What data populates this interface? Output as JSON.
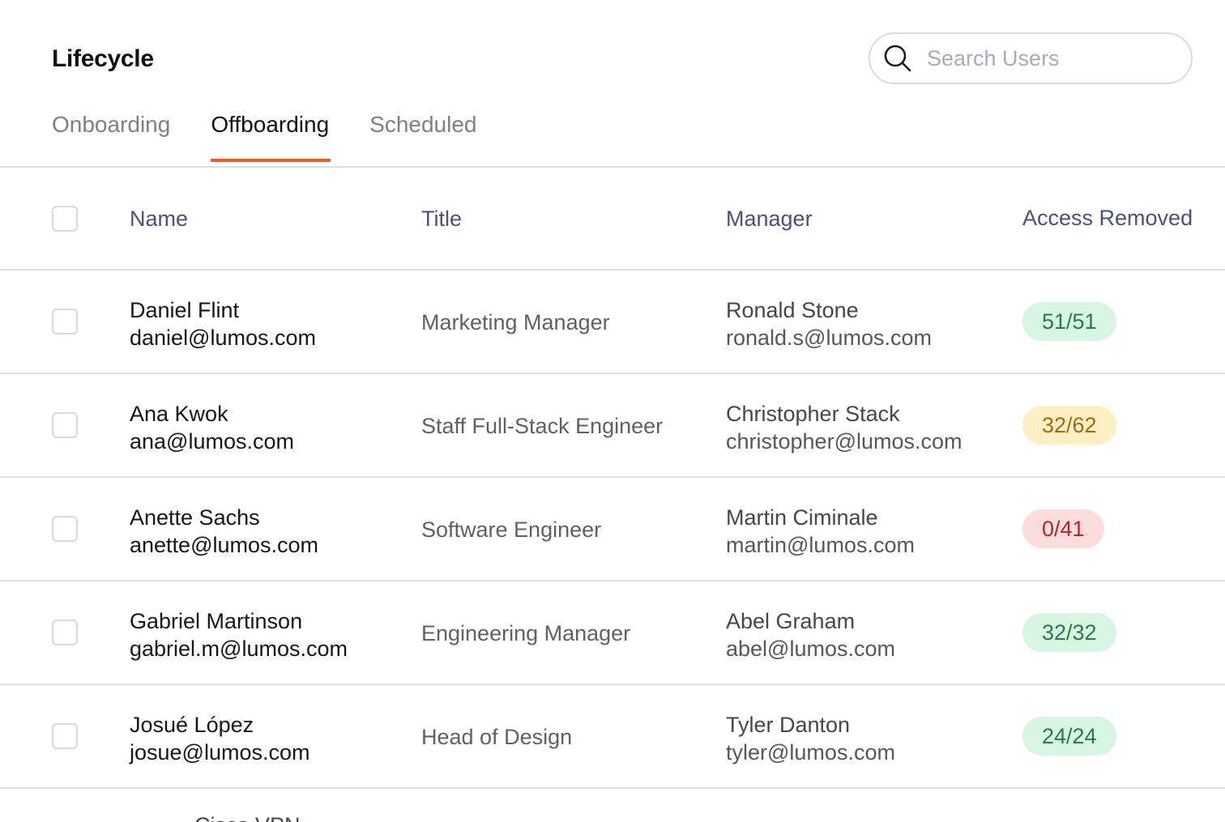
{
  "header": {
    "title": "Lifecycle"
  },
  "search": {
    "placeholder": "Search Users",
    "icon": "search-icon"
  },
  "tabs": [
    {
      "label": "Onboarding",
      "active": false
    },
    {
      "label": "Offboarding",
      "active": true
    },
    {
      "label": "Scheduled",
      "active": false
    }
  ],
  "colors": {
    "tab_active_underline": "#f05a28",
    "header_text": "#4d4f7c",
    "badge_green_bg": "#d6f5e3",
    "badge_yellow_bg": "#fcefc4",
    "badge_red_bg": "#fcdcdc"
  },
  "table": {
    "columns": [
      "Name",
      "Title",
      "Manager",
      "Access Removed"
    ],
    "rows": [
      {
        "name": "Daniel Flint",
        "email": "daniel@lumos.com",
        "title": "Marketing Manager",
        "manager_name": "Ronald Stone",
        "manager_email": "ronald.s@lumos.com",
        "access": "51/51",
        "status": "green"
      },
      {
        "name": "Ana Kwok",
        "email": "ana@lumos.com",
        "title": "Staff Full-Stack Engineer",
        "manager_name": "Christopher Stack",
        "manager_email": "christopher@lumos.com",
        "access": "32/62",
        "status": "yellow"
      },
      {
        "name": "Anette Sachs",
        "email": "anette@lumos.com",
        "title": "Software Engineer",
        "manager_name": "Martin Ciminale",
        "manager_email": "martin@lumos.com",
        "access": "0/41",
        "status": "red"
      },
      {
        "name": "Gabriel Martinson",
        "email": "gabriel.m@lumos.com",
        "title": "Engineering Manager",
        "manager_name": "Abel Graham",
        "manager_email": "abel@lumos.com",
        "access": "32/32",
        "status": "green"
      },
      {
        "name": "Josué López",
        "email": "josue@lumos.com",
        "title": "Head of Design",
        "manager_name": "Tyler Danton",
        "manager_email": "tyler@lumos.com",
        "access": "24/24",
        "status": "green"
      }
    ]
  },
  "cutoff_text": "Cisco VPN"
}
